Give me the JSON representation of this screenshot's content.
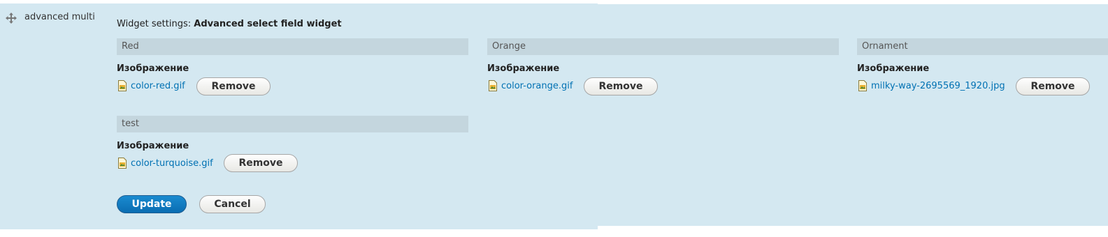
{
  "row": {
    "name": "advanced multi"
  },
  "settings": {
    "prefix": "Widget settings:",
    "widget_name": "Advanced select field widget"
  },
  "fieldsets": [
    {
      "legend": "Red",
      "field_label": "Изображение",
      "file_name": "color-red.gif",
      "remove_label": "Remove"
    },
    {
      "legend": "Orange",
      "field_label": "Изображение",
      "file_name": "color-orange.gif",
      "remove_label": "Remove"
    },
    {
      "legend": "Ornament",
      "field_label": "Изображение",
      "file_name": "milky-way-2695569_1920.jpg",
      "remove_label": "Remove"
    },
    {
      "legend": "test",
      "field_label": "Изображение",
      "file_name": "color-turquoise.gif",
      "remove_label": "Remove"
    }
  ],
  "actions": {
    "update_label": "Update",
    "cancel_label": "Cancel"
  },
  "colors": {
    "row_background": "#d4e8f1",
    "legend_background": "#c4d6de",
    "link": "#0071b3",
    "primary_button": "#0a6db2"
  },
  "icons": {
    "drag": "move-arrows-icon",
    "file": "image-file-icon"
  }
}
